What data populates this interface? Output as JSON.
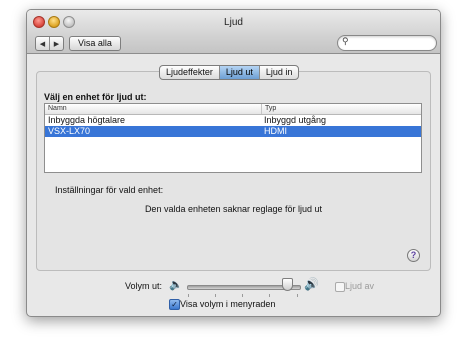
{
  "window": {
    "title": "Ljud"
  },
  "toolbar": {
    "back_glyph": "◀",
    "forward_glyph": "▶",
    "show_all_label": "Visa alla",
    "search_placeholder": "",
    "search_icon": "magnifier-icon"
  },
  "tabs": [
    {
      "label": "Ljudeffekter",
      "active": false
    },
    {
      "label": "Ljud ut",
      "active": true
    },
    {
      "label": "Ljud in",
      "active": false
    }
  ],
  "output": {
    "section_title": "Välj en enhet för ljud ut:",
    "columns": [
      "Namn",
      "Typ"
    ],
    "rows": [
      {
        "name": "Inbyggda högtalare",
        "type": "Inbyggd utgång",
        "selected": false
      },
      {
        "name": "VSX-LX70",
        "type": "HDMI",
        "selected": true
      }
    ],
    "settings_label": "Inställningar för vald enhet:",
    "no_controls_message": "Den valda enheten saknar reglage för ljud ut"
  },
  "help": {
    "glyph": "?"
  },
  "volume": {
    "label": "Volym ut:",
    "level": 0.9,
    "low_icon": "speaker-low-icon",
    "high_icon": "speaker-high-icon",
    "mute_label": "Ljud av",
    "mute_checked": false,
    "show_in_menubar_label": "Visa volym i menyraden",
    "show_in_menubar_checked": true
  },
  "colors": {
    "selection": "#3875d7",
    "tab_active": "#6d9fd4",
    "window_bg": "#e8e8e8"
  }
}
